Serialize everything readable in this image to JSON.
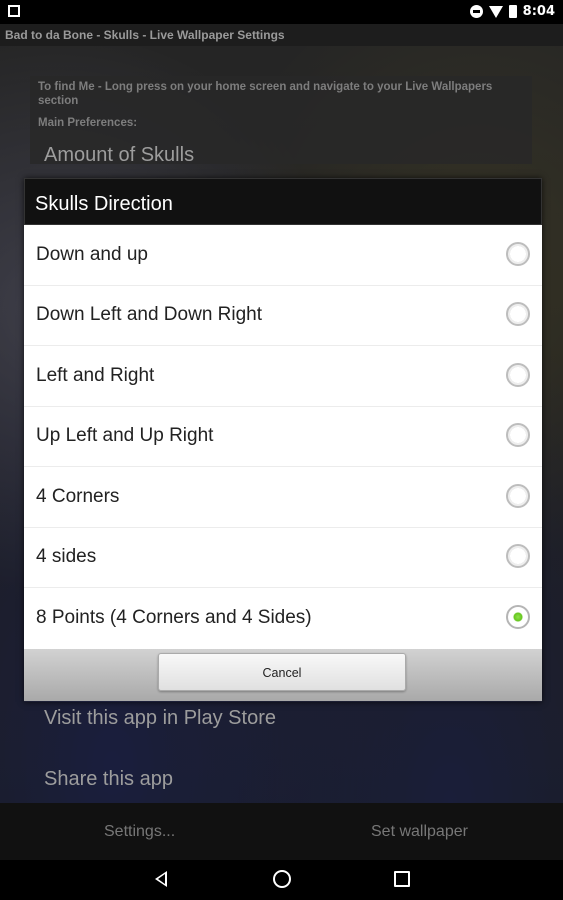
{
  "status_bar": {
    "time": "8:04"
  },
  "app_title": "Bad to da Bone - Skulls - Live Wallpaper Settings",
  "settings": {
    "info_text": "To find Me - Long press on your home screen and navigate to your Live Wallpapers section",
    "main_preferences_header": "Main Preferences:",
    "items": [
      "Amount of Skulls",
      "Visit this app in Play Store",
      "Share this app"
    ]
  },
  "dialog": {
    "title": "Skulls Direction",
    "options": [
      {
        "label": "Down and up",
        "selected": false
      },
      {
        "label": "Down Left and Down Right",
        "selected": false
      },
      {
        "label": "Left and Right",
        "selected": false
      },
      {
        "label": "Up Left and Up Right",
        "selected": false
      },
      {
        "label": "4 Corners",
        "selected": false
      },
      {
        "label": "4 sides",
        "selected": false
      },
      {
        "label": "8 Points (4 Corners and 4 Sides)",
        "selected": true
      }
    ],
    "cancel_label": "Cancel"
  },
  "bottom_bar": {
    "settings_label": "Settings...",
    "set_wallpaper_label": "Set wallpaper"
  }
}
